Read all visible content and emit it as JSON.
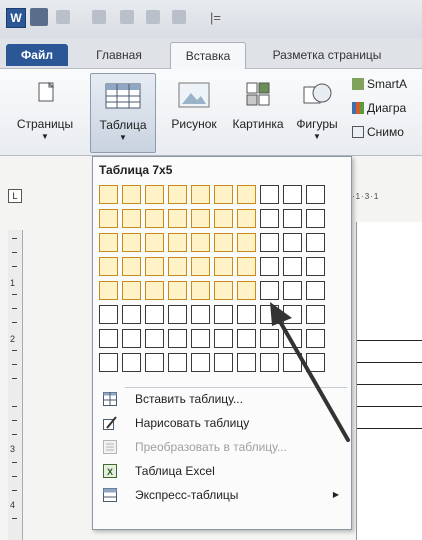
{
  "titlebar": {
    "app_icon_letter": "W",
    "separator": "|="
  },
  "tabs": [
    {
      "label": "Файл"
    },
    {
      "label": "Главная"
    },
    {
      "label": "Вставка"
    },
    {
      "label": "Разметка страницы"
    }
  ],
  "ribbon": {
    "pages_label": "Страницы",
    "table_label": "Таблица",
    "picture_label": "Рисунок",
    "clipart_label": "Картинка",
    "shapes_label": "Фигуры",
    "smartart_label": "SmartA",
    "chart_label": "Диагра",
    "screenshot_label": "Снимо"
  },
  "ruler": {
    "corner": "L",
    "numbers": [
      "1",
      "2",
      "3",
      "4"
    ],
    "top_marks": "·1·3·1"
  },
  "table_menu": {
    "title": "Таблица 7x5",
    "grid_cols": 10,
    "grid_rows": 8,
    "selected_cols": 7,
    "selected_rows": 5,
    "items": [
      {
        "label": "Вставить таблицу...",
        "icon": "insert-table-icon",
        "enabled": true
      },
      {
        "label": "Нарисовать таблицу",
        "icon": "draw-table-icon",
        "enabled": true
      },
      {
        "label": "Преобразовать в таблицу...",
        "icon": "convert-table-icon",
        "enabled": false
      },
      {
        "label": "Таблица Excel",
        "icon": "excel-table-icon",
        "enabled": true
      },
      {
        "label": "Экспресс-таблицы",
        "icon": "quick-tables-icon",
        "enabled": true,
        "submenu": true
      }
    ]
  },
  "colors": {
    "file_tab": "#2b5797",
    "selection_border": "#c98c1b",
    "selection_fill": "#fff2c7"
  }
}
